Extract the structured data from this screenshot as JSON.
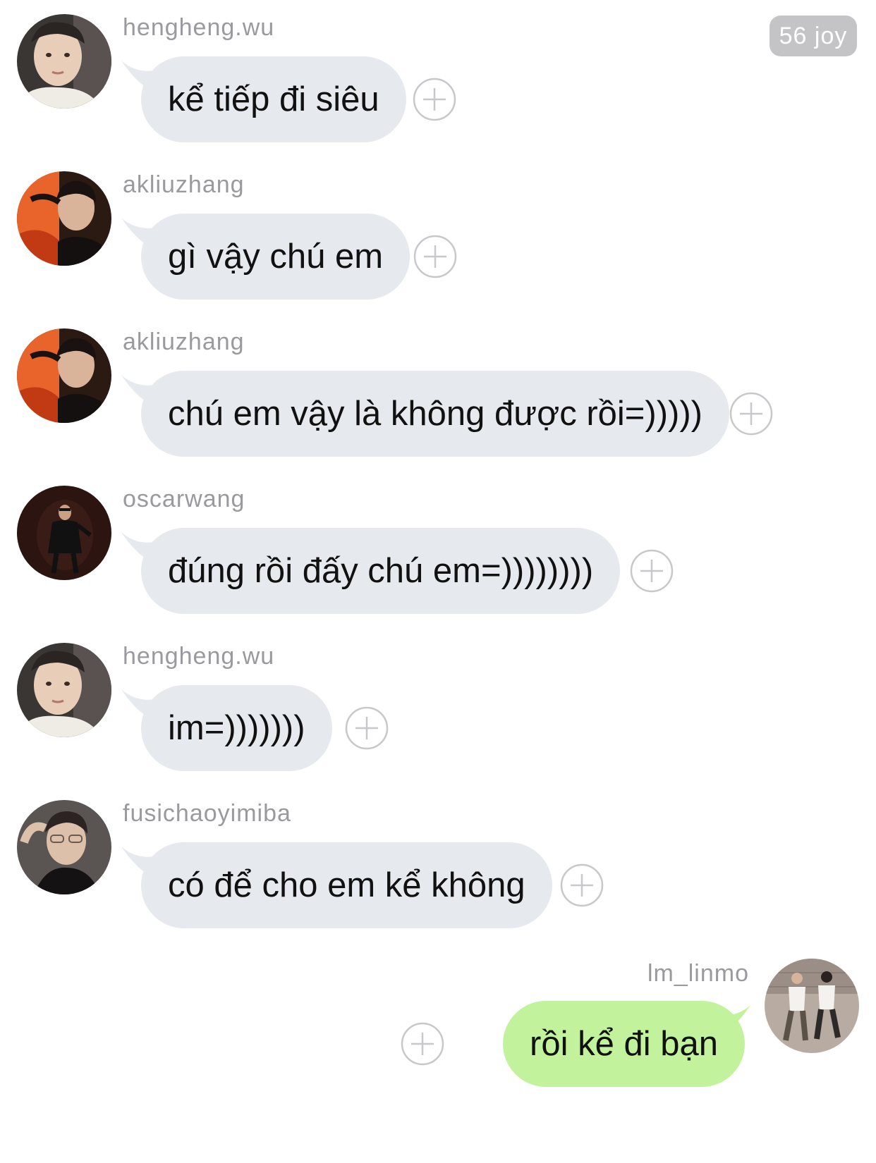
{
  "badge": {
    "label": "56 joy"
  },
  "messages": [
    {
      "user": "hengheng.wu",
      "text": "kể tiếp đi siêu",
      "avatar_icon": "avatar-hengheng-wu"
    },
    {
      "user": "akliuzhang",
      "text": "gì vậy chú em",
      "avatar_icon": "avatar-akliuzhang"
    },
    {
      "user": "akliuzhang",
      "text": "chú em vậy là không được rồi=)))))",
      "avatar_icon": "avatar-akliuzhang"
    },
    {
      "user": "oscarwang",
      "text": "đúng rồi đấy chú em=))))))))",
      "avatar_icon": "avatar-oscarwang"
    },
    {
      "user": "hengheng.wu",
      "text": "im=)))))))",
      "avatar_icon": "avatar-hengheng-wu"
    },
    {
      "user": "fusichaoyimiba",
      "text": "có để cho em kể không",
      "avatar_icon": "avatar-fusichaoyimiba"
    },
    {
      "user": "lm_linmo",
      "text": "rồi kể đi bạn",
      "avatar_icon": "avatar-lm-linmo",
      "outgoing": true
    }
  ],
  "colors": {
    "incoming_bubble": "#e6e9ed",
    "outgoing_bubble": "#c2f29b",
    "username_text": "#9a9a9e",
    "badge_bg": "#c4c4c6",
    "plus_icon": "#c8c8cc"
  }
}
